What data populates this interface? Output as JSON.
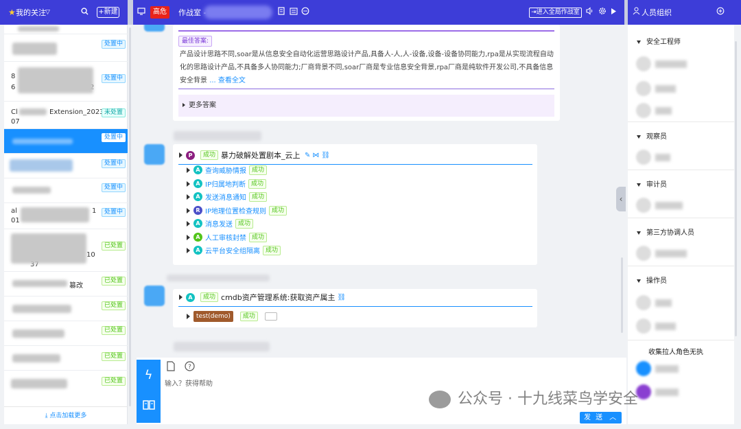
{
  "left_header": {
    "title": "我的关注",
    "new_button": "+新建"
  },
  "topbar": {
    "alert_badge": "高危",
    "room_title": "作战室 -",
    "enter_button": "进入全局作战室"
  },
  "right_header": {
    "title": "人员组织"
  },
  "list": {
    "item_texts": [
      "Cl",
      "Extension_202303",
      "07",
      "8",
      "2",
      "fi",
      "al",
      "1",
      "01",
      "10",
      "37",
      "篡改"
    ],
    "statuses": [
      "处置中",
      "处置中",
      "未处置",
      "处置中",
      "处置中",
      "处置中",
      "处置中",
      "已处置",
      "已处置",
      "已处置",
      "已处置",
      "已处置",
      "已处置"
    ],
    "load_more": "点击加载更多"
  },
  "best_answer": {
    "tag": "最佳答案:",
    "text": "产品设计思路不同,soar是从信息安全自动化运营思路设计产品,具备人-人,人-设备,设备-设备协同能力,rpa是从实现流程自动化的思路设计产品,不具备多人协同能力;厂商背景不同,soar厂商是专业信息安全背景,rpa厂商是纯软件开发公司,不具备信息安全背景",
    "more_link": "... 查看全文",
    "more_answers": "更多答案"
  },
  "playbook": {
    "icon_letter": "P",
    "status": "成功",
    "title": "暴力破解处置剧本_云上",
    "steps": [
      {
        "letter": "A",
        "name": "查询威胁情报",
        "status": "成功"
      },
      {
        "letter": "A",
        "name": "IP归属地判断",
        "status": "成功"
      },
      {
        "letter": "A",
        "name": "发送消息通知",
        "status": "成功"
      },
      {
        "letter": "R",
        "name": "IP地理位置检查规则",
        "status": "成功"
      },
      {
        "letter": "A",
        "name": "消息发送",
        "status": "成功"
      },
      {
        "letter": "A",
        "name": "人工审核封禁",
        "status": "成功"
      },
      {
        "letter": "A",
        "name": "云平台安全组隔离",
        "status": "成功"
      }
    ]
  },
  "action": {
    "icon_letter": "A",
    "status": "成功",
    "title": "cmdb资产管理系统:获取资产属主",
    "demo_tag": "test(demo)",
    "demo_status": "成功"
  },
  "input": {
    "hint": "输入？获得帮助",
    "send_button": "发 送"
  },
  "groups": [
    {
      "name": "安全工程师"
    },
    {
      "name": "观察员"
    },
    {
      "name": "审计员"
    },
    {
      "name": "第三方协调人员"
    },
    {
      "name": "操作员"
    },
    {
      "name": "收集拉人角色无执"
    }
  ],
  "watermark": "公众号 · 十九线菜鸟学安全",
  "colors": {
    "topbar": "#3d3dd8",
    "accent": "#1890ff",
    "danger": "#e8231a",
    "success": "#52c41a"
  }
}
